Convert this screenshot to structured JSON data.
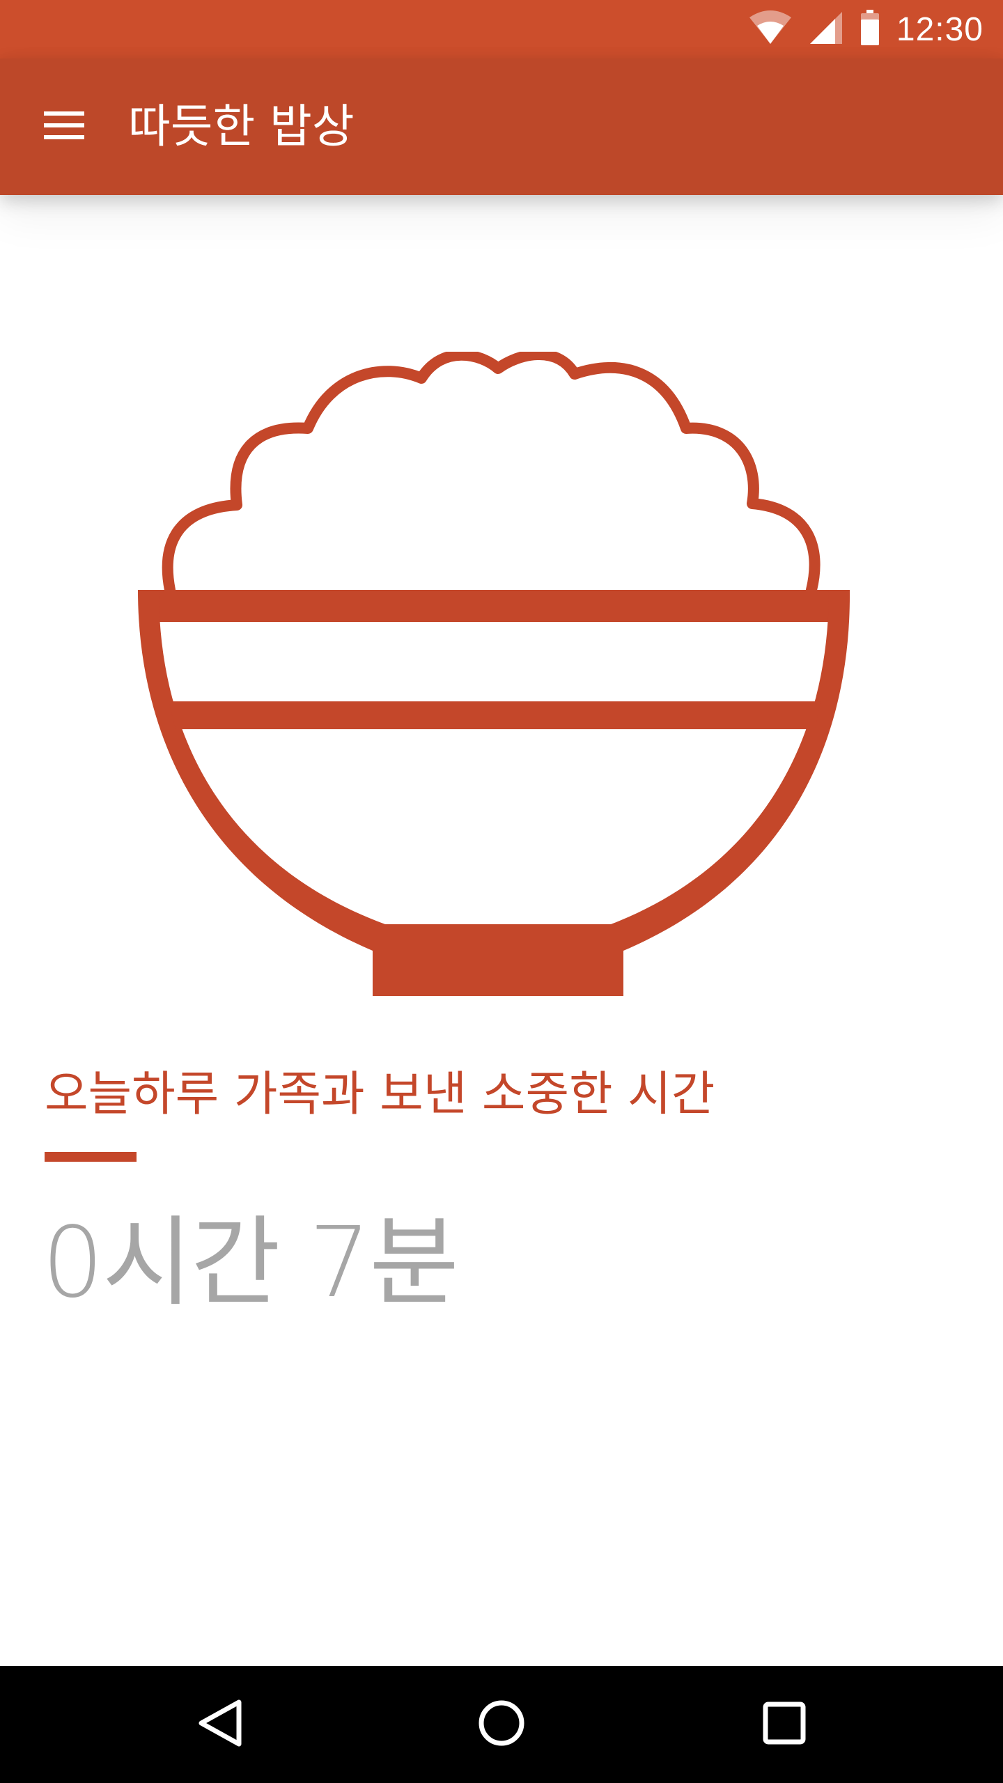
{
  "status_bar": {
    "time": "12:30",
    "icons": [
      "wifi-icon",
      "cell-signal-icon",
      "battery-icon"
    ]
  },
  "app_bar": {
    "menu_icon": "hamburger-menu-icon",
    "title": "따듯한 밥상"
  },
  "illustration": {
    "icon": "rice-bowl-icon"
  },
  "main": {
    "caption": "오늘하루 가족과 보낸 소중한 시간",
    "time_value": "0시간 7분"
  },
  "nav_bar": {
    "icons": [
      "back-icon",
      "home-icon",
      "recents-icon"
    ]
  },
  "colors": {
    "status_bar": "#cc4e2c",
    "app_bar": "#bd4829",
    "accent": "#c4472a",
    "time_text": "#a6a6a6",
    "nav_bar": "#000000"
  }
}
